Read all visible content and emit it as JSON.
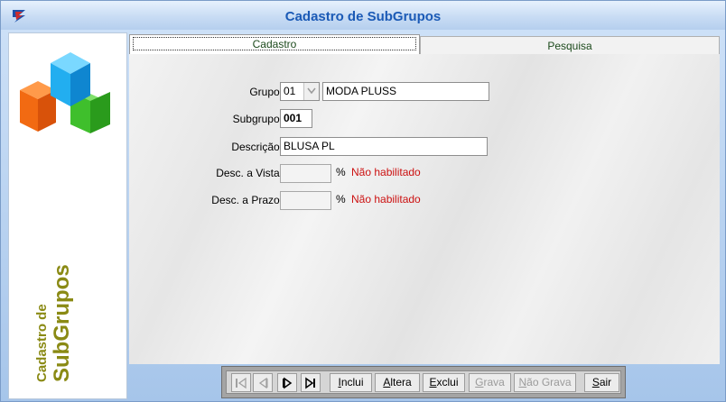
{
  "window": {
    "title": "Cadastro de SubGrupos"
  },
  "side": {
    "line1": "Cadastro de",
    "line2": "SubGrupos"
  },
  "tabs": [
    {
      "label": "Cadastro",
      "active": true
    },
    {
      "label": "Pesquisa",
      "active": false
    }
  ],
  "form": {
    "grupo": {
      "label": "Grupo:",
      "code": "01",
      "name": "MODA PLUSS"
    },
    "subgrupo": {
      "label": "Subgrupo:",
      "value": "001"
    },
    "descricao": {
      "label": "Descrição:",
      "value": "BLUSA PL"
    },
    "desc_vista": {
      "label": "Desc. a Vista:",
      "value": "",
      "unit": "%",
      "status": "Não habilitado"
    },
    "desc_prazo": {
      "label": "Desc. a Prazo:",
      "value": "",
      "unit": "%",
      "status": "Não habilitado"
    }
  },
  "toolbar": {
    "first_icon": "first-record-icon",
    "prev_icon": "previous-record-icon",
    "next_icon": "next-record-icon",
    "last_icon": "last-record-icon",
    "inclui": {
      "first": "I",
      "rest": "nclui"
    },
    "altera": {
      "first": "A",
      "rest": "ltera"
    },
    "exclui": {
      "first": "E",
      "rest": "xclui"
    },
    "grava": {
      "first": "G",
      "rest": "rava"
    },
    "nao_grava": {
      "first": "N",
      "rest": "ão Grava"
    },
    "sair": {
      "first": "S",
      "rest": "air"
    }
  },
  "colors": {
    "title": "#1b5ab6",
    "side_text": "#8a8a14",
    "status_red": "#cc1111",
    "titlebar": "#c8dcf4"
  }
}
